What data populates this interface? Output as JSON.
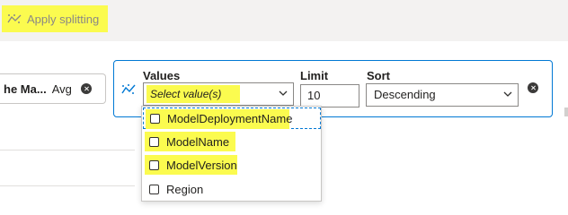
{
  "toolbar": {
    "apply_splitting_label": "Apply splitting"
  },
  "metric_pill": {
    "name": "he Ma...",
    "aggregation": "Avg"
  },
  "split": {
    "values_label": "Values",
    "values_placeholder": "Select value(s)",
    "limit_label": "Limit",
    "limit_value": "10",
    "sort_label": "Sort",
    "sort_value": "Descending"
  },
  "dropdown": {
    "options": [
      {
        "label": "ModelDeploymentName",
        "checked": false,
        "highlighted": true
      },
      {
        "label": "ModelName",
        "checked": false,
        "highlighted": true
      },
      {
        "label": "ModelVersion",
        "checked": false,
        "highlighted": true
      },
      {
        "label": "Region",
        "checked": false,
        "highlighted": false
      }
    ]
  },
  "colors": {
    "accent": "#0078d4",
    "highlight": "#fbfb4f",
    "toolbar_bg": "#f3f2f1"
  }
}
